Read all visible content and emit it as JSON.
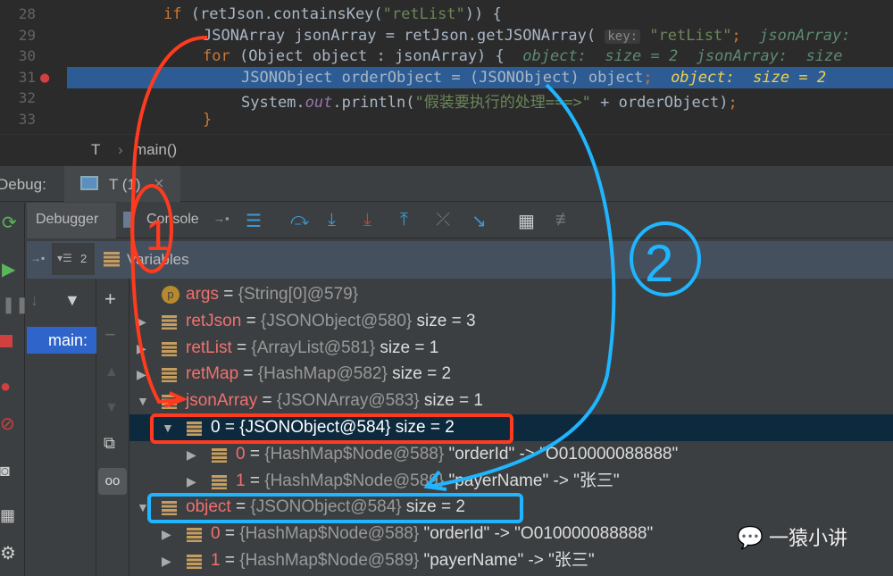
{
  "editor": {
    "lines": [
      {
        "n": "28",
        "parts": [
          [
            "kw",
            "if "
          ],
          [
            "",
            "(retJson.containsKey("
          ],
          [
            "str",
            "\"retList\""
          ],
          [
            "",
            "))"
          ],
          [
            "",
            " {"
          ]
        ]
      },
      {
        "n": "29",
        "parts": [
          [
            "",
            "JSONArray jsonArray = retJson.getJSONArray( "
          ],
          [
            "hint",
            "key:"
          ],
          [
            "str",
            " \"retList\""
          ],
          [
            "kw",
            ";"
          ],
          [
            "inl",
            "  jsonArray:"
          ]
        ]
      },
      {
        "n": "30",
        "parts": [
          [
            "kw",
            "for "
          ],
          [
            "",
            "(Object object : jsonArray) {"
          ],
          [
            "inl",
            "  object:  size = 2  jsonArray:  size"
          ]
        ]
      },
      {
        "n": "31",
        "parts": [
          [
            "",
            "JSONObject orderObject = (JSONObject) object"
          ],
          [
            "kw",
            ";"
          ],
          [
            "inlh",
            "  object:  size = 2"
          ]
        ]
      },
      {
        "n": "32",
        "parts": [
          [
            "",
            "System."
          ],
          [
            "out",
            "out"
          ],
          [
            "",
            ".println("
          ],
          [
            "str",
            "\"假装要执行的处理===>\""
          ],
          [
            "",
            " + orderObject)"
          ],
          [
            "kw",
            ";"
          ]
        ]
      },
      {
        "n": "33",
        "parts": [
          [
            "kw",
            "}"
          ]
        ]
      }
    ]
  },
  "breadcrumb": {
    "class": "T",
    "sep": "›",
    "method": "main()"
  },
  "debug": {
    "label": "Debug:",
    "tab": "T (1)",
    "close": "×"
  },
  "toolbar": {
    "debugger": "Debugger",
    "console": "Console"
  },
  "variables": {
    "header": "Variables",
    "frame_count": "2",
    "frame": "main:",
    "rows": [
      {
        "name": "args",
        "type": "{String[0]@579}",
        "extra": "",
        "indent": 0,
        "tri": "",
        "icon": "p"
      },
      {
        "name": "retJson",
        "type": "{JSONObject@580}",
        "extra": " size = 3",
        "indent": 0,
        "tri": "▶"
      },
      {
        "name": "retList",
        "type": "{ArrayList@581}",
        "extra": " size = 1",
        "indent": 0,
        "tri": "▶"
      },
      {
        "name": "retMap",
        "type": "{HashMap@582}",
        "extra": " size = 2",
        "indent": 0,
        "tri": "▶"
      },
      {
        "name": "jsonArray",
        "type": "{JSONArray@583}",
        "extra": " size = 1",
        "indent": 0,
        "tri": "▼"
      },
      {
        "name": "0",
        "type": "{JSONObject@584}",
        "extra": " size = 2",
        "indent": 1,
        "tri": "▼",
        "sel": true
      },
      {
        "name": "0",
        "type": "{HashMap$Node@588}",
        "extra": " \"orderId\" -> \"O010000088888\"",
        "indent": 2,
        "tri": "▶"
      },
      {
        "name": "1",
        "type": "{HashMap$Node@589}",
        "extra": " \"payerName\" -> \"张三\"",
        "indent": 2,
        "tri": "▶"
      },
      {
        "name": "object",
        "type": "{JSONObject@584}",
        "extra": " size = 2",
        "indent": 0,
        "tri": "▼"
      },
      {
        "name": "0",
        "type": "{HashMap$Node@588}",
        "extra": " \"orderId\" -> \"O010000088888\"",
        "indent": 1,
        "tri": "▶"
      },
      {
        "name": "1",
        "type": "{HashMap$Node@589}",
        "extra": " \"payerName\" -> \"张三\"",
        "indent": 1,
        "tri": "▶"
      }
    ]
  },
  "annotations": {
    "one": "1",
    "two": "2"
  },
  "watermark": "一猿小讲",
  "colors": {
    "red": "#ff3b1f",
    "blue": "#1fb6ff"
  }
}
